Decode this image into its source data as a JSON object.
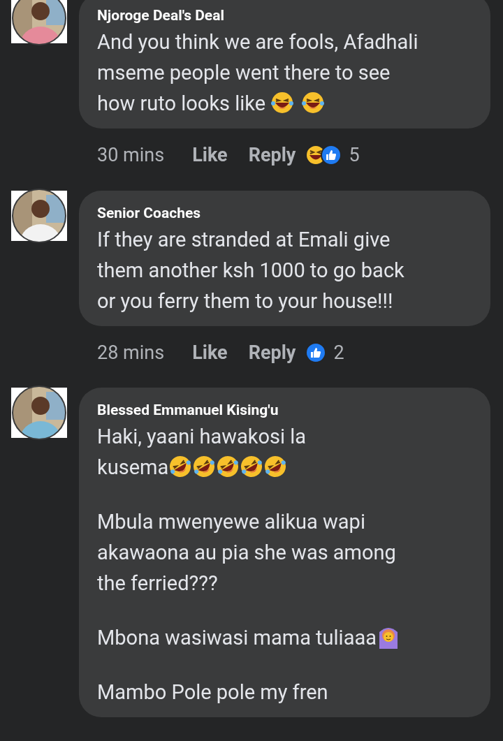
{
  "comments": [
    {
      "author": "Njoroge Deal's Deal",
      "paragraphs": [
        [
          [
            {
              "kind": "text",
              "text": "And you think we are fools, Afadhali"
            }
          ],
          [
            {
              "kind": "text",
              "text": "mseme people went there to see"
            }
          ],
          [
            {
              "kind": "text",
              "text": "how ruto looks like "
            },
            {
              "kind": "laugh"
            },
            {
              "kind": "gap"
            },
            {
              "kind": "laugh"
            }
          ]
        ]
      ],
      "time": "30 mins",
      "like": "Like",
      "reply": "Reply",
      "reactions": [
        {
          "kind": "haha"
        },
        {
          "kind": "like"
        }
      ],
      "count": "5"
    },
    {
      "author": "Senior Coaches",
      "paragraphs": [
        [
          [
            {
              "kind": "text",
              "text": "If they are stranded at Emali give"
            }
          ],
          [
            {
              "kind": "text",
              "text": "them another ksh 1000 to go back"
            }
          ],
          [
            {
              "kind": "text",
              "text": "or you ferry them to your house!!!"
            }
          ]
        ]
      ],
      "time": "28 mins",
      "like": "Like",
      "reply": "Reply",
      "reactions": [
        {
          "kind": "like"
        }
      ],
      "count": "2"
    },
    {
      "author": "Blessed Emmanuel Kising'u",
      "paragraphs": [
        [
          [
            {
              "kind": "text",
              "text": "Haki, yaani hawakosi la"
            }
          ],
          [
            {
              "kind": "text",
              "text": "kusema"
            },
            {
              "kind": "rofl"
            },
            {
              "kind": "rofl"
            },
            {
              "kind": "rofl"
            },
            {
              "kind": "rofl"
            },
            {
              "kind": "rofl"
            }
          ]
        ],
        [
          [
            {
              "kind": "text",
              "text": "Mbula mwenyewe alikua wapi"
            }
          ],
          [
            {
              "kind": "text",
              "text": "akawaona au pia she was among"
            }
          ],
          [
            {
              "kind": "text",
              "text": "the ferried???"
            }
          ]
        ],
        [
          [
            {
              "kind": "text",
              "text": "Mbona wasiwasi mama tuliaaa"
            },
            {
              "kind": "gesture"
            }
          ]
        ],
        [
          [
            {
              "kind": "text",
              "text": "Mambo Pole pole my fren"
            }
          ]
        ]
      ]
    }
  ]
}
